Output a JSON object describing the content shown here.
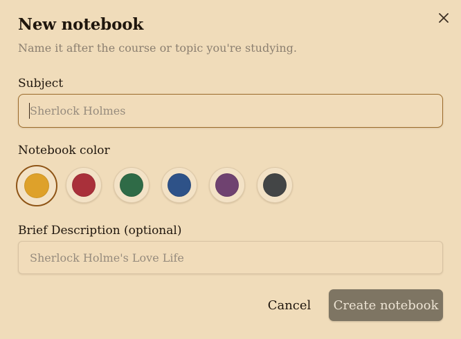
{
  "dialog": {
    "title": "New notebook",
    "subtitle": "Name it after the course or topic you're studying."
  },
  "subject": {
    "label": "Subject",
    "placeholder": "Sherlock Holmes",
    "value": ""
  },
  "color": {
    "label": "Notebook color",
    "selected_index": 0,
    "swatches": [
      {
        "name": "yellow",
        "hex": "#DEA12A"
      },
      {
        "name": "red",
        "hex": "#A9303A"
      },
      {
        "name": "green",
        "hex": "#2F6B47"
      },
      {
        "name": "blue",
        "hex": "#2E5288"
      },
      {
        "name": "purple",
        "hex": "#6F4270"
      },
      {
        "name": "charcoal",
        "hex": "#434546"
      }
    ]
  },
  "description": {
    "label": "Brief Description (optional)",
    "placeholder": "Sherlock Holme's Love Life",
    "value": ""
  },
  "actions": {
    "cancel_label": "Cancel",
    "create_label": "Create notebook"
  },
  "icons": {
    "close": "close-icon"
  }
}
